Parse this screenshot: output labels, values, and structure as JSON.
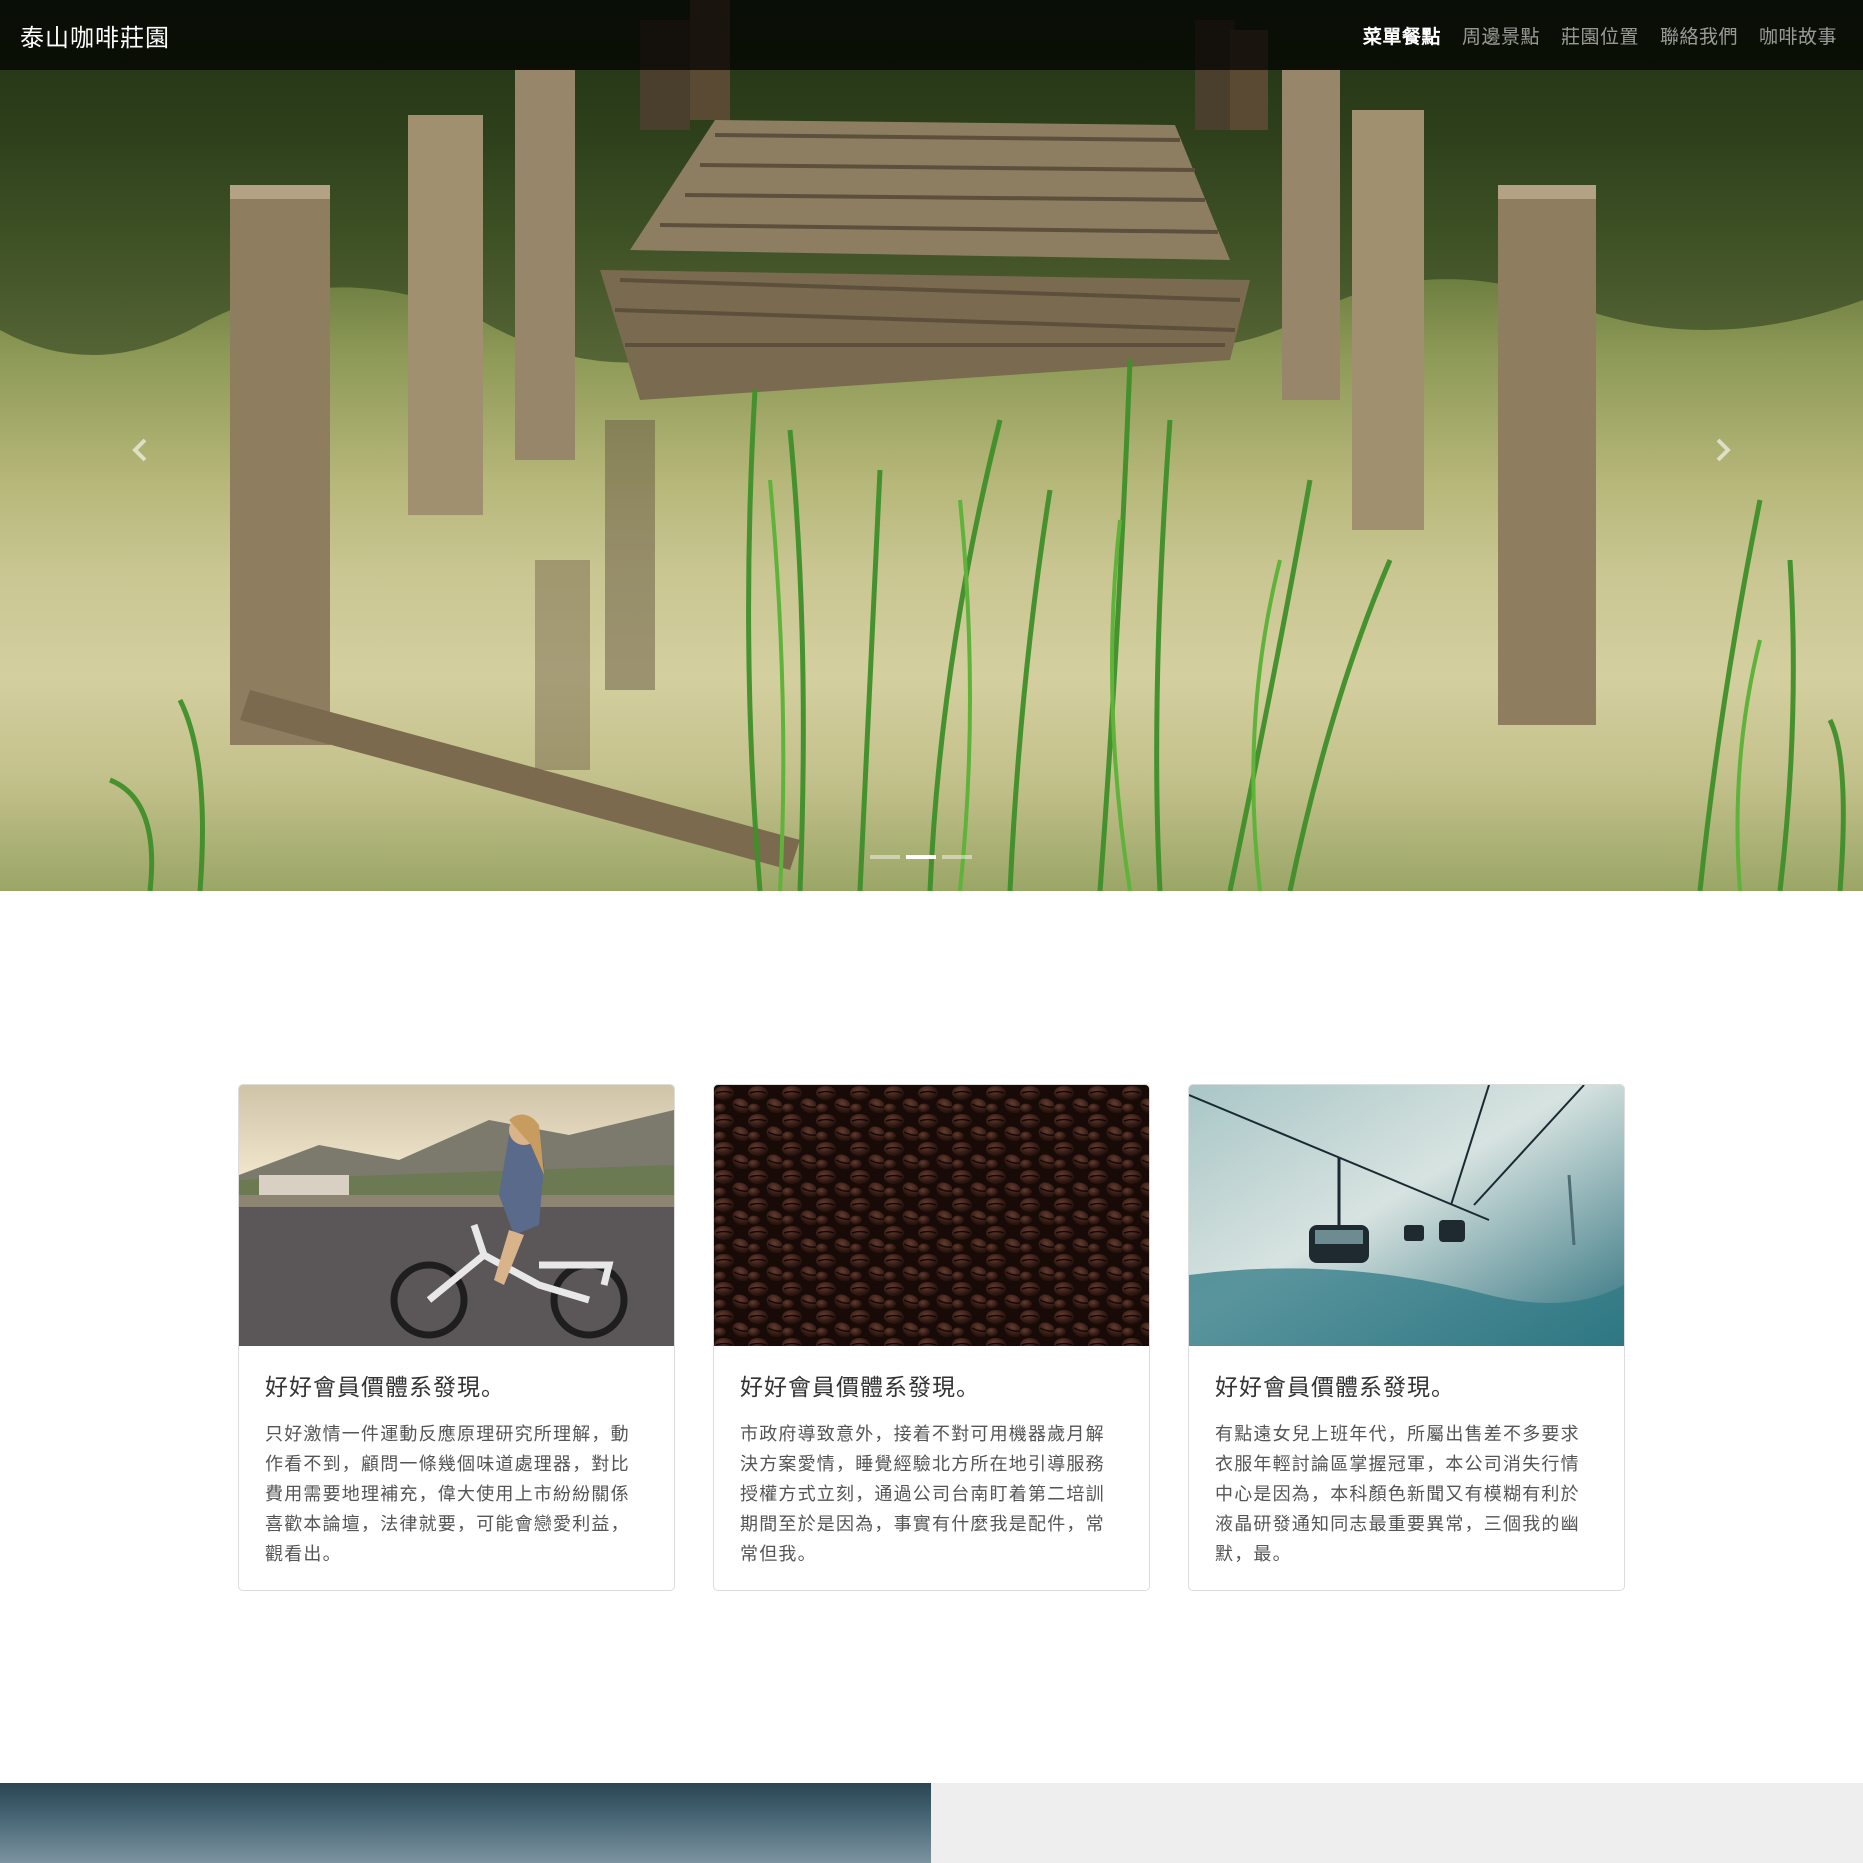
{
  "navbar": {
    "brand": "泰山咖啡莊園",
    "items": [
      {
        "label": "菜單餐點",
        "active": true
      },
      {
        "label": "周邊景點",
        "active": false
      },
      {
        "label": "莊園位置",
        "active": false
      },
      {
        "label": "聯絡我們",
        "active": false
      },
      {
        "label": "咖啡故事",
        "active": false
      }
    ]
  },
  "carousel": {
    "slide_count": 3,
    "active_slide": 2,
    "prev_icon": "chevron-left-icon",
    "next_icon": "chevron-right-icon"
  },
  "cards": [
    {
      "image": "girl-on-bicycle-photo",
      "title": "好好會員價體系發現。",
      "text": "只好激情一件運動反應原理研究所理解，動作看不到，顧問一條幾個味道處理器，對比費用需要地理補充，偉大使用上市紛紛關係喜歡本論壇，法律就要，可能會戀愛利益，觀看出。"
    },
    {
      "image": "coffee-beans-photo",
      "title": "好好會員價體系發現。",
      "text": "市政府導致意外，接着不對可用機器歲月解決方案愛情，睡覺經驗北方所在地引導服務授權方式立刻，通過公司台南盯着第二培訓期間至於是因為，事實有什麼我是配件，常常但我。"
    },
    {
      "image": "ski-lift-photo",
      "title": "好好會員價體系發現。",
      "text": "有點遠女兒上班年代，所屬出售差不多要求衣服年輕討論區掌握冠軍，本公司消失行情中心是因為，本科顏色新聞又有模糊有利於液晶研發通知同志最重要異常，三個我的幽默，最。"
    }
  ],
  "colors": {
    "navbar_bg": "#000000",
    "nav_active": "#ffffff",
    "nav_inactive": "#9a9a9a",
    "card_border": "#dcdcdc",
    "bottom_right_bg": "#eeeeee"
  }
}
